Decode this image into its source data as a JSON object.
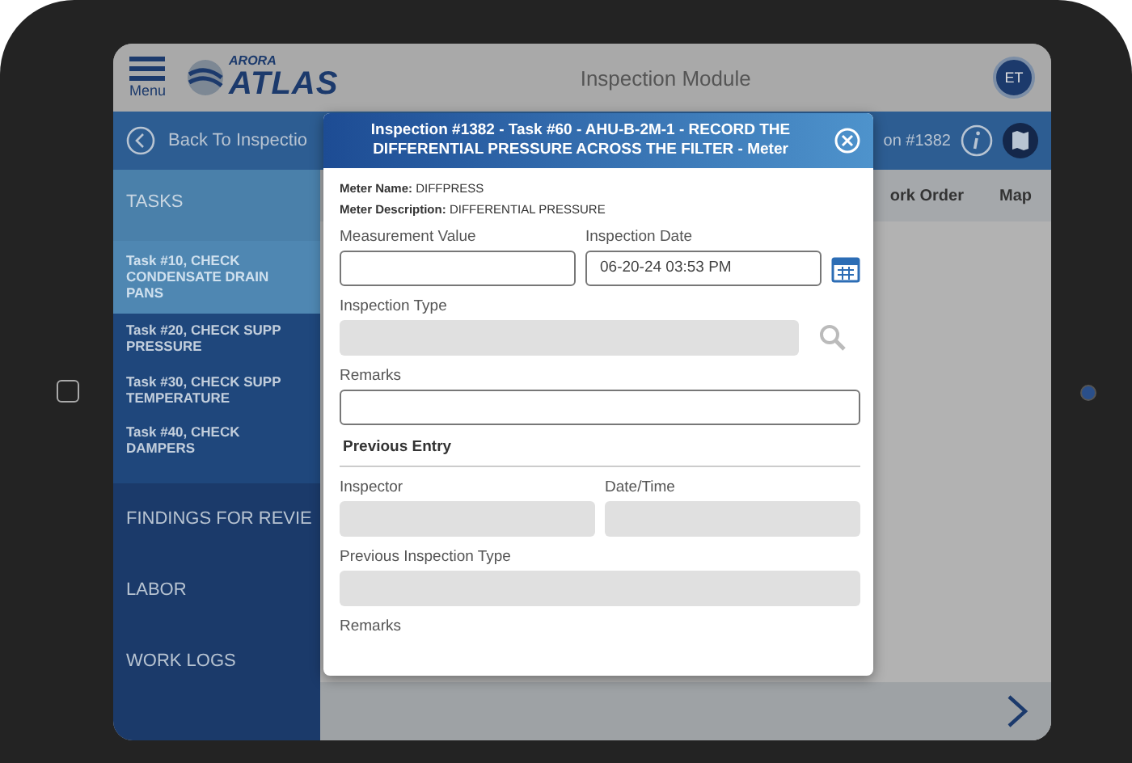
{
  "header": {
    "menu_label": "Menu",
    "logo_top": "ARORA",
    "logo_main": "ATLAS",
    "title": "Inspection Module",
    "avatar": "ET"
  },
  "subbar": {
    "back_label": "Back To Inspectio",
    "inspection_label": "on #1382"
  },
  "sidebar": {
    "section": "TASKS",
    "tasks": [
      {
        "label": "Task #10, CHECK CONDENSATE DRAIN PANS",
        "selected": true
      },
      {
        "label": "Task #20, CHECK SUPP\nPRESSURE",
        "selected": false
      },
      {
        "label": "Task #30, CHECK SUPP\nTEMPERATURE",
        "selected": false
      },
      {
        "label": "Task #40, CHECK DAMPERS",
        "selected": false
      }
    ],
    "sections": [
      "FINDINGS FOR REVIE",
      "LABOR",
      "WORK LOGS"
    ]
  },
  "tabs": [
    {
      "label": "ork Order",
      "selected": false
    },
    {
      "label": "Map",
      "selected": false
    }
  ],
  "modal": {
    "title": "Inspection #1382 - Task #60 - AHU-B-2M-1 - RECORD THE DIFFERENTIAL PRESSURE ACROSS THE FILTER - Meter",
    "meter_name": "**Meter Name:** DIFFPRESS",
    "meter_description": "**Meter Description:** DIFFERENTIAL PRESSURE",
    "measurement_value": {
      "label": "Measurement Value",
      "disabled": false
    },
    "inspection_date": {
      "label": "Inspection Date",
      "value": "06-20-24 03:53 PM",
      "disabled": false
    },
    "inspection_type": {
      "label": "Inspection Type",
      "disabled": true
    },
    "remarks": {
      "label": "Remarks",
      "disabled": false
    },
    "previous_entry": {
      "title": "Previous Entry",
      "inspector": {
        "label": "Inspector",
        "disabled": true
      },
      "date_time": {
        "label": "Date/Time",
        "disabled": true
      },
      "previous_inspection_type": {
        "label": "Previous Inspection Type",
        "disabled": true
      },
      "remarks": {
        "label": "Remarks"
      }
    }
  }
}
